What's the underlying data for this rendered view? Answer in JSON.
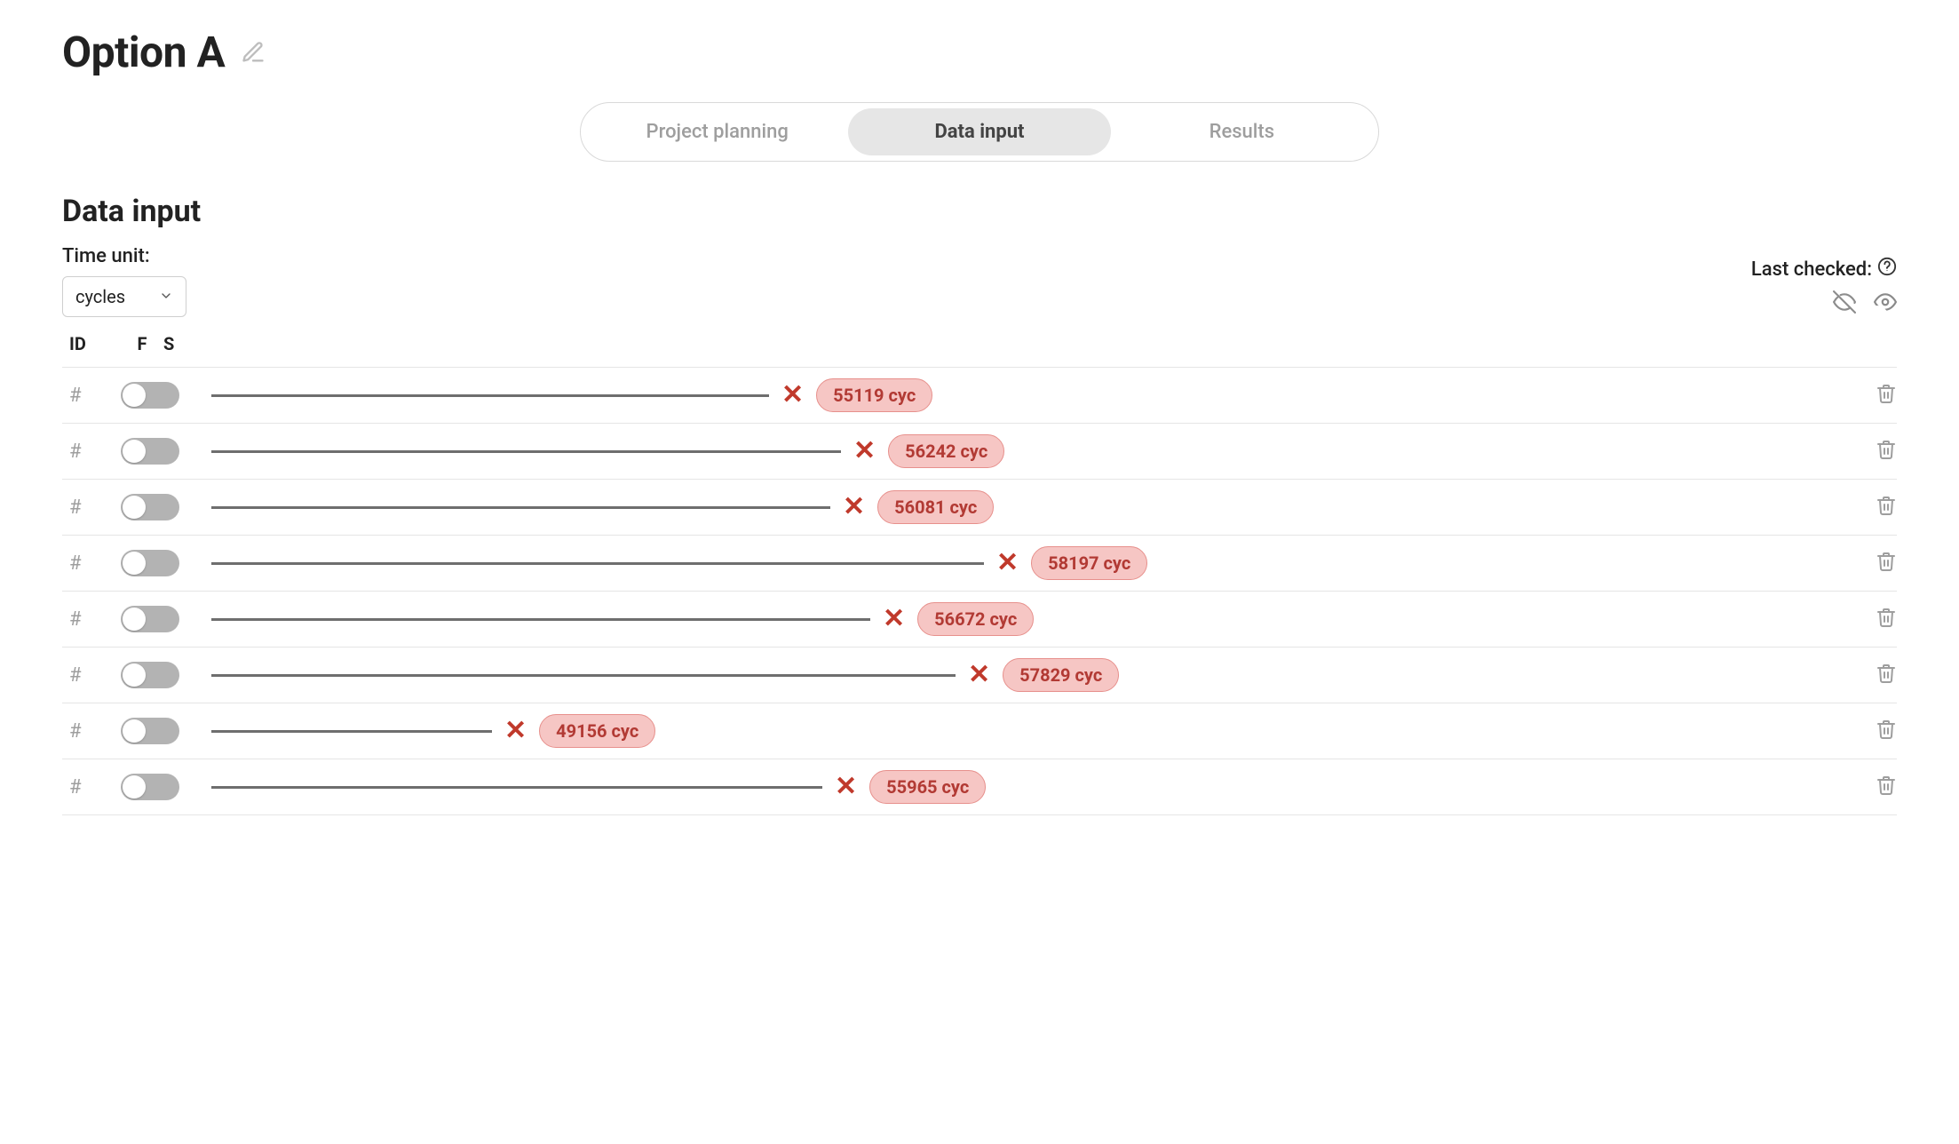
{
  "title": "Option A",
  "tabs": [
    {
      "label": "Project planning",
      "active": false
    },
    {
      "label": "Data input",
      "active": true
    },
    {
      "label": "Results",
      "active": false
    }
  ],
  "section_title": "Data input",
  "time_unit": {
    "label": "Time unit:",
    "value": "cycles"
  },
  "last_checked": {
    "label": "Last checked:"
  },
  "columns": {
    "id": "ID",
    "f": "F",
    "s": "S"
  },
  "id_placeholder": "#",
  "unit_suffix": "cyc",
  "max_value": 58197,
  "rows": [
    {
      "value": 55119
    },
    {
      "value": 56242
    },
    {
      "value": 56081
    },
    {
      "value": 58197
    },
    {
      "value": 56672
    },
    {
      "value": 57829
    },
    {
      "value": 49156
    },
    {
      "value": 55965
    }
  ]
}
